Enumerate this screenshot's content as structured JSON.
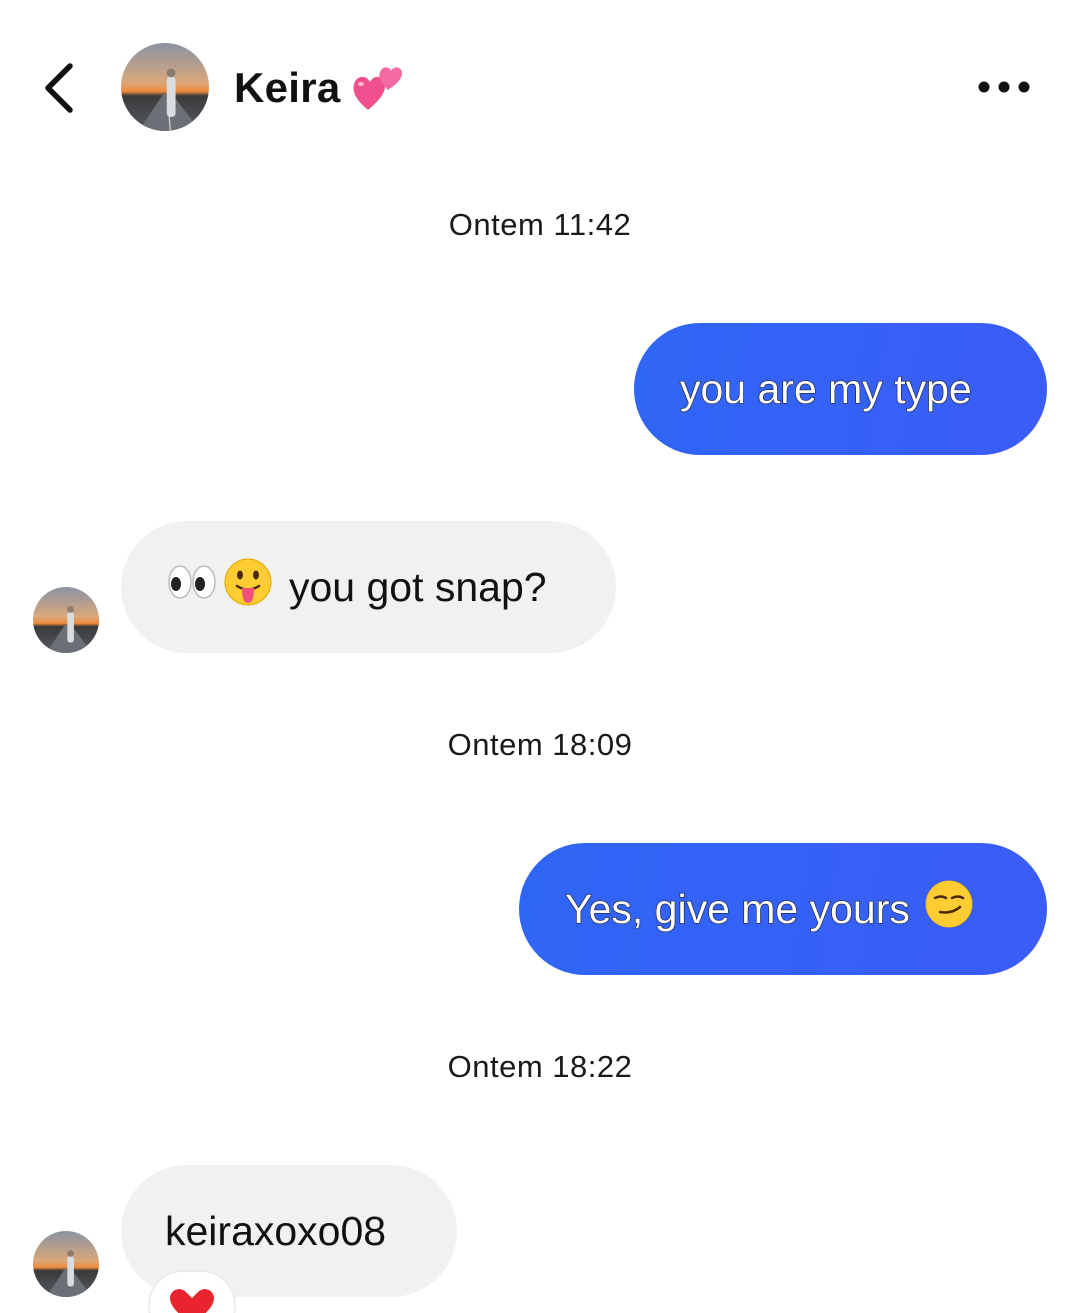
{
  "header": {
    "contact_name": "Keira",
    "name_emoji": "two-hearts-emoji"
  },
  "messages": [
    {
      "type": "timestamp",
      "text": "Ontem 11:42"
    },
    {
      "type": "outgoing",
      "text": "you are my type"
    },
    {
      "type": "incoming",
      "text": "you got snap?",
      "emojis": [
        "eyes-emoji",
        "tongue-out-face-emoji"
      ]
    },
    {
      "type": "timestamp",
      "text": "Ontem 18:09"
    },
    {
      "type": "outgoing",
      "text": "Yes, give me yours",
      "emojis": [
        "smirking-face-emoji"
      ]
    },
    {
      "type": "timestamp",
      "text": "Ontem 18:22"
    },
    {
      "type": "incoming",
      "text": "keiraxoxo08",
      "reaction": "red-heart-emoji"
    }
  ],
  "colors": {
    "outgoing_bubble_start": "#2f66f5",
    "outgoing_bubble_end": "#3a5cf7",
    "incoming_bubble": "#f1f1f2"
  }
}
